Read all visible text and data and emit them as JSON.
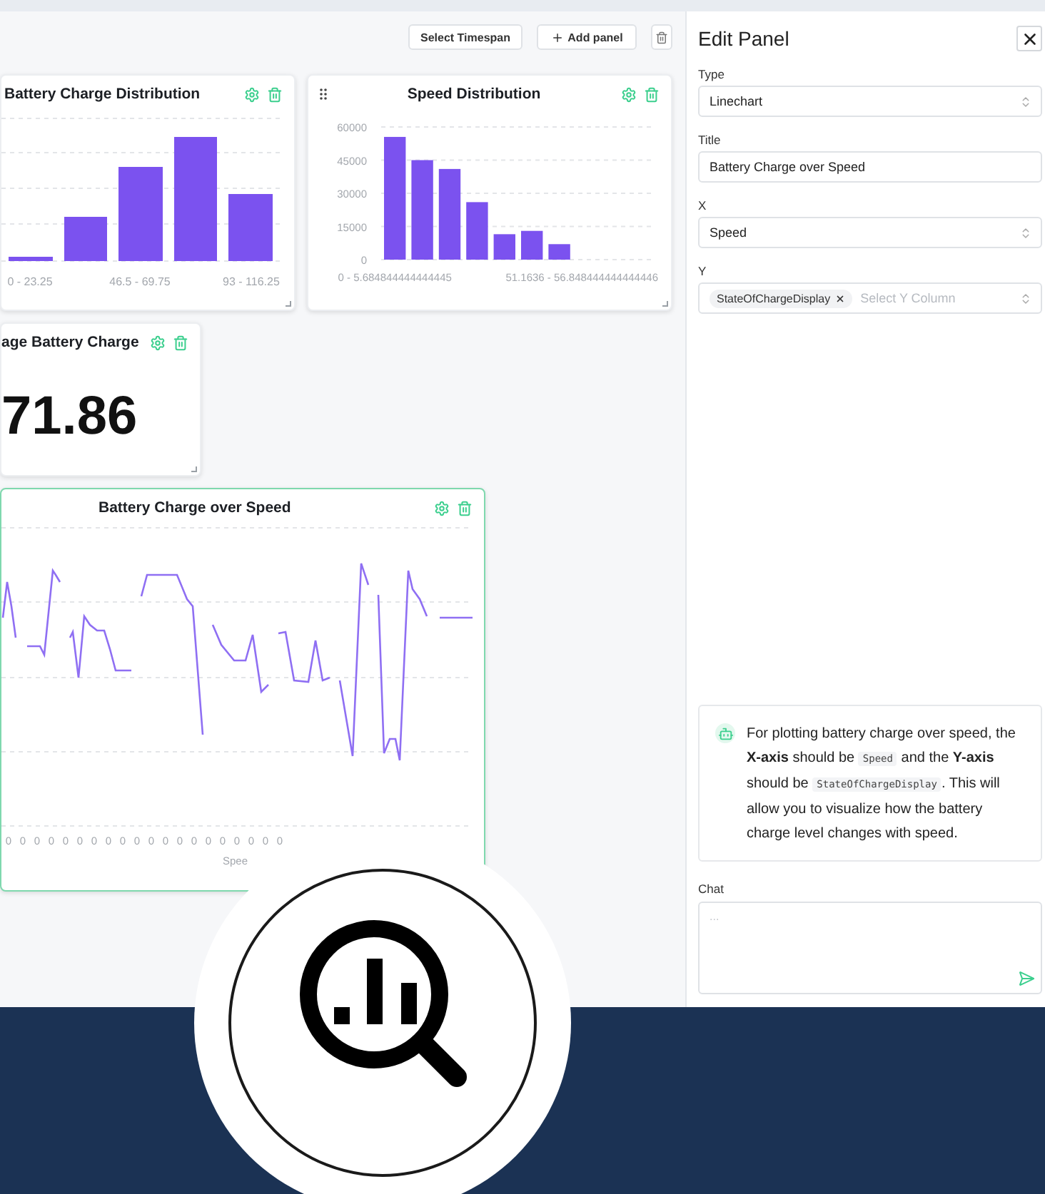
{
  "toolbar": {
    "buttons": [
      {
        "kind": "text",
        "label": "Select Timespan"
      },
      {
        "kind": "add",
        "label": "Add panel"
      },
      {
        "kind": "delete"
      }
    ]
  },
  "panels": [
    {
      "kind": "histogram",
      "title": "Battery Charge Distribution",
      "selected": false,
      "draggable": false,
      "x_labels": [
        "0 - 23.25",
        "46.5 - 69.75",
        "93 - 116.25"
      ]
    },
    {
      "kind": "bar",
      "title": "Speed Distribution",
      "selected": false,
      "draggable": true,
      "chart_data": {
        "type": "bar",
        "categories": [
          "0 - 5.684844444444445",
          null,
          null,
          null,
          null,
          null,
          null,
          null,
          null,
          null
        ],
        "annotations": [
          "51.1636 - 56.848444444444446"
        ],
        "values": [
          55500,
          45000,
          41000,
          26000,
          11500,
          13000,
          7000,
          0,
          0,
          0
        ],
        "grid": true,
        "ylim": [
          0,
          60000
        ],
        "yticks": [
          0,
          15000,
          30000,
          45000,
          60000
        ]
      }
    },
    {
      "kind": "stat",
      "title": "age Battery Charge",
      "selected": false,
      "draggable": false,
      "value": "71.86"
    },
    {
      "kind": "line",
      "title": "Battery Charge over Speed",
      "selected": true,
      "draggable": false,
      "x_ticks": [
        "0",
        "0",
        "0",
        "0",
        "0",
        "0",
        "0",
        "0",
        "0",
        "0",
        "0",
        "0",
        "0",
        "0",
        "0",
        "0",
        "0",
        "0",
        "0",
        "0"
      ],
      "xlabel": "Spee"
    }
  ],
  "edit_panel": {
    "title": "Edit Panel",
    "fields": [
      {
        "kind": "select",
        "label": "Type",
        "value": "Linechart"
      },
      {
        "kind": "text",
        "label": "Title",
        "value": "Battery Charge over Speed"
      },
      {
        "kind": "select",
        "label": "X",
        "value": "Speed"
      },
      {
        "kind": "multiselect",
        "label": "Y",
        "chips": [
          "StateOfChargeDisplay"
        ],
        "placeholder": "Select Y Column"
      }
    ],
    "message": [
      {
        "kind": "text",
        "text": "For plotting battery charge over speed, the **X-axis** should be "
      },
      {
        "kind": "code",
        "text": "Speed"
      },
      {
        "kind": "text",
        "text": " and the **Y-axis** should be "
      },
      {
        "kind": "code",
        "text": "StateOfChargeDisplay"
      },
      {
        "kind": "text",
        "text": ". This will allow you to visualize how the battery charge level changes with speed."
      }
    ],
    "chat": {
      "label": "Chat",
      "placeholder": "..."
    }
  }
}
